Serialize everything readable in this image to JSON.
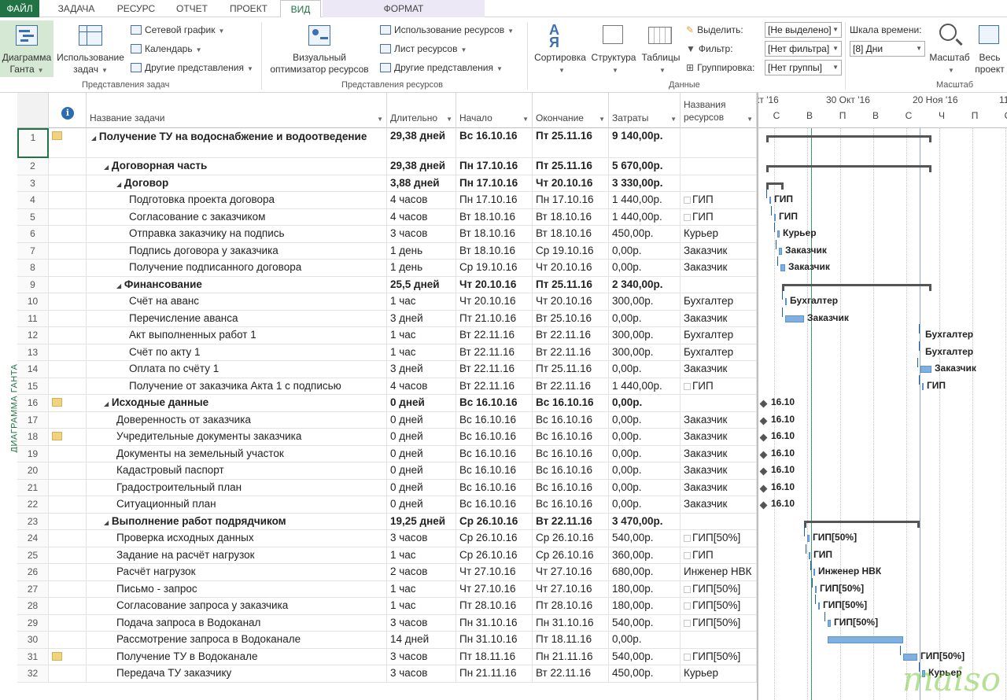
{
  "tabs": [
    {
      "label": "ФАЙЛ"
    },
    {
      "label": "ЗАДАЧА"
    },
    {
      "label": "РЕСУРС"
    },
    {
      "label": "ОТЧЕТ"
    },
    {
      "label": "ПРОЕКТ"
    },
    {
      "label": "ВИД"
    },
    {
      "label": "ФОРМАТ"
    }
  ],
  "ribbon": {
    "task_views": {
      "gantt_label1": "Диаграмма",
      "gantt_label2": "Ганта",
      "usage_label1": "Использование",
      "usage_label2": "задач",
      "network": "Сетевой график",
      "calendar": "Календарь",
      "other": "Другие представления",
      "group": "Представления задач"
    },
    "resource_views": {
      "visual1": "Визуальный",
      "visual2": "оптимизатор ресурсов",
      "usage": "Использование ресурсов",
      "sheet": "Лист ресурсов",
      "other": "Другие представления",
      "group": "Представления ресурсов"
    },
    "data": {
      "sort": "Сортировка",
      "outline": "Структура",
      "tables": "Таблицы",
      "highlight": "Выделить:",
      "filter": "Фильтр:",
      "group_by": "Группировка:",
      "highlight_val": "[Не выделено]",
      "filter_val": "[Нет фильтра]",
      "group_val": "[Нет группы]",
      "group": "Данные"
    },
    "zoom": {
      "timescale": "Шкала времени:",
      "timescale_val": "[8] Дни",
      "zoom": "Масштаб",
      "whole1": "Весь",
      "whole2": "проект",
      "group": "Масштаб"
    }
  },
  "side_label": "ДИАГРАММА ГАНТА",
  "columns": {
    "info": "i",
    "name": "Название задачи",
    "duration": "Длительно",
    "start": "Начало",
    "finish": "Окончание",
    "cost": "Затраты",
    "res1": "Названия",
    "res2": "ресурсов"
  },
  "rows": [
    {
      "id": "1",
      "note": true,
      "name": "Получение ТУ на водоснабжение и водоотведение",
      "dur": "29,38 дней",
      "start": "Вс 16.10.16",
      "finish": "Пт 25.11.16",
      "cost": "9 140,00р.",
      "res": "",
      "bold": true,
      "level": 0,
      "tall": true
    },
    {
      "id": "2",
      "name": "Договорная часть",
      "dur": "29,38 дней",
      "start": "Пн 17.10.16",
      "finish": "Пт 25.11.16",
      "cost": "5 670,00р.",
      "res": "",
      "bold": true,
      "level": 1
    },
    {
      "id": "3",
      "name": "Договор",
      "dur": "3,88 дней",
      "start": "Пн 17.10.16",
      "finish": "Чт 20.10.16",
      "cost": "3 330,00р.",
      "res": "",
      "bold": true,
      "level": 2
    },
    {
      "id": "4",
      "name": "Подготовка проекта договора",
      "dur": "4 часов",
      "start": "Пн 17.10.16",
      "finish": "Пн 17.10.16",
      "cost": "1 440,00р.",
      "res": "ГИП",
      "level": 3,
      "ric": true
    },
    {
      "id": "5",
      "name": "Согласование с заказчиком",
      "dur": "4 часов",
      "start": "Вт 18.10.16",
      "finish": "Вт 18.10.16",
      "cost": "1 440,00р.",
      "res": "ГИП",
      "level": 3,
      "ric": true
    },
    {
      "id": "6",
      "name": "Отправка заказчику на подпись",
      "dur": "3 часов",
      "start": "Вт 18.10.16",
      "finish": "Вт 18.10.16",
      "cost": "450,00р.",
      "res": "Курьер",
      "level": 3
    },
    {
      "id": "7",
      "name": "Подпись договора у заказчика",
      "dur": "1 день",
      "start": "Вт 18.10.16",
      "finish": "Ср 19.10.16",
      "cost": "0,00р.",
      "res": "Заказчик",
      "level": 3
    },
    {
      "id": "8",
      "name": "Получение подписанного договора",
      "dur": "1 день",
      "start": "Ср 19.10.16",
      "finish": "Чт 20.10.16",
      "cost": "0,00р.",
      "res": "Заказчик",
      "level": 3
    },
    {
      "id": "9",
      "name": "Финансование",
      "dur": "25,5 дней",
      "start": "Чт 20.10.16",
      "finish": "Пт 25.11.16",
      "cost": "2 340,00р.",
      "res": "",
      "bold": true,
      "level": 2
    },
    {
      "id": "10",
      "name": "Счёт на аванс",
      "dur": "1 час",
      "start": "Чт 20.10.16",
      "finish": "Чт 20.10.16",
      "cost": "300,00р.",
      "res": "Бухгалтер",
      "level": 3
    },
    {
      "id": "11",
      "name": "Перечисление аванса",
      "dur": "3 дней",
      "start": "Пт 21.10.16",
      "finish": "Вт 25.10.16",
      "cost": "0,00р.",
      "res": "Заказчик",
      "level": 3
    },
    {
      "id": "12",
      "name": "Акт выполненных работ 1",
      "dur": "1 час",
      "start": "Вт 22.11.16",
      "finish": "Вт 22.11.16",
      "cost": "300,00р.",
      "res": "Бухгалтер",
      "level": 3
    },
    {
      "id": "13",
      "name": "Счёт по акту 1",
      "dur": "1 час",
      "start": "Вт 22.11.16",
      "finish": "Вт 22.11.16",
      "cost": "300,00р.",
      "res": "Бухгалтер",
      "level": 3
    },
    {
      "id": "14",
      "name": "Оплата по счёту 1",
      "dur": "3 дней",
      "start": "Вт 22.11.16",
      "finish": "Пт 25.11.16",
      "cost": "0,00р.",
      "res": "Заказчик",
      "level": 3
    },
    {
      "id": "15",
      "name": "Получение от заказчика Акта 1 с подписью",
      "dur": "4 часов",
      "start": "Вт 22.11.16",
      "finish": "Вт 22.11.16",
      "cost": "1 440,00р.",
      "res": "ГИП",
      "level": 3,
      "ric": true
    },
    {
      "id": "16",
      "note": true,
      "name": "Исходные данные",
      "dur": "0 дней",
      "start": "Вс 16.10.16",
      "finish": "Вс 16.10.16",
      "cost": "0,00р.",
      "res": "",
      "bold": true,
      "level": 1
    },
    {
      "id": "17",
      "name": "Доверенность от заказчика",
      "dur": "0 дней",
      "start": "Вс 16.10.16",
      "finish": "Вс 16.10.16",
      "cost": "0,00р.",
      "res": "Заказчик",
      "level": 2
    },
    {
      "id": "18",
      "note": true,
      "name": "Учредительные документы заказчика",
      "dur": "0 дней",
      "start": "Вс 16.10.16",
      "finish": "Вс 16.10.16",
      "cost": "0,00р.",
      "res": "Заказчик",
      "level": 2
    },
    {
      "id": "19",
      "name": "Документы на земельный участок",
      "dur": "0 дней",
      "start": "Вс 16.10.16",
      "finish": "Вс 16.10.16",
      "cost": "0,00р.",
      "res": "Заказчик",
      "level": 2
    },
    {
      "id": "20",
      "name": "Кадастровый паспорт",
      "dur": "0 дней",
      "start": "Вс 16.10.16",
      "finish": "Вс 16.10.16",
      "cost": "0,00р.",
      "res": "Заказчик",
      "level": 2
    },
    {
      "id": "21",
      "name": "Градостроительный план",
      "dur": "0 дней",
      "start": "Вс 16.10.16",
      "finish": "Вс 16.10.16",
      "cost": "0,00р.",
      "res": "Заказчик",
      "level": 2
    },
    {
      "id": "22",
      "name": "Ситуационный план",
      "dur": "0 дней",
      "start": "Вс 16.10.16",
      "finish": "Вс 16.10.16",
      "cost": "0,00р.",
      "res": "Заказчик",
      "level": 2
    },
    {
      "id": "23",
      "name": "Выполнение работ подрядчиком",
      "dur": "19,25 дней",
      "start": "Ср 26.10.16",
      "finish": "Вт 22.11.16",
      "cost": "3 470,00р.",
      "res": "",
      "bold": true,
      "level": 1
    },
    {
      "id": "24",
      "name": "Проверка исходных данных",
      "dur": "3 часов",
      "start": "Ср 26.10.16",
      "finish": "Ср 26.10.16",
      "cost": "540,00р.",
      "res": "ГИП[50%]",
      "level": 2,
      "ric": true
    },
    {
      "id": "25",
      "name": "Задание на расчёт нагрузок",
      "dur": "1 час",
      "start": "Ср 26.10.16",
      "finish": "Ср 26.10.16",
      "cost": "360,00р.",
      "res": "ГИП",
      "level": 2,
      "ric": true
    },
    {
      "id": "26",
      "name": "Расчёт нагрузок",
      "dur": "2 часов",
      "start": "Чт 27.10.16",
      "finish": "Чт 27.10.16",
      "cost": "680,00р.",
      "res": "Инженер НВК",
      "level": 2
    },
    {
      "id": "27",
      "name": "Письмо - запрос",
      "dur": "1 час",
      "start": "Чт 27.10.16",
      "finish": "Чт 27.10.16",
      "cost": "180,00р.",
      "res": "ГИП[50%]",
      "level": 2,
      "ric": true
    },
    {
      "id": "28",
      "name": "Согласование запроса у заказчика",
      "dur": "1 час",
      "start": "Пт 28.10.16",
      "finish": "Пт 28.10.16",
      "cost": "180,00р.",
      "res": "ГИП[50%]",
      "level": 2,
      "ric": true
    },
    {
      "id": "29",
      "name": "Подача запроса в Водоканал",
      "dur": "3 часов",
      "start": "Пн 31.10.16",
      "finish": "Пн 31.10.16",
      "cost": "540,00р.",
      "res": "ГИП[50%]",
      "level": 2,
      "ric": true
    },
    {
      "id": "30",
      "name": "Рассмотрение запроса в Водоканале",
      "dur": "14 дней",
      "start": "Пн 31.10.16",
      "finish": "Пт 18.11.16",
      "cost": "0,00р.",
      "res": "",
      "level": 2
    },
    {
      "id": "31",
      "note": true,
      "name": "Получение ТУ  в Водоканале",
      "dur": "3 часов",
      "start": "Пт 18.11.16",
      "finish": "Пн 21.11.16",
      "cost": "540,00р.",
      "res": "ГИП[50%]",
      "level": 2,
      "ric": true
    },
    {
      "id": "32",
      "name": "Передача ТУ заказчику",
      "dur": "3 часов",
      "start": "Пн 21.11.16",
      "finish": "Вт 22.11.16",
      "cost": "450,00р.",
      "res": "Курьер",
      "level": 2
    }
  ],
  "timescale": {
    "major": [
      "кт '16",
      "30 Окт '16",
      "20 Ноя '16",
      "11"
    ],
    "minor": [
      "С",
      "В",
      "П",
      "В",
      "С",
      "Ч",
      "П",
      "С"
    ]
  },
  "gantt_labels": {
    "r4": "ГИП",
    "r5": "ГИП",
    "r6": "Курьер",
    "r7": "Заказчик",
    "r8": "Заказчик",
    "r10": "Бухгалтер",
    "r11": "Заказчик",
    "r12": "Бухгалтер",
    "r13": "Бухгалтер",
    "r14": "Заказчик",
    "r15": "ГИП",
    "r16": "16.10",
    "r17": "16.10",
    "r18": "16.10",
    "r19": "16.10",
    "r20": "16.10",
    "r21": "16.10",
    "r22": "16.10",
    "r24": "ГИП[50%]",
    "r25": "ГИП",
    "r26": "Инженер НВК",
    "r27": "ГИП[50%]",
    "r28": "ГИП[50%]",
    "r29": "ГИП[50%]",
    "r31": "ГИП[50%]",
    "r32": "Курьер"
  },
  "watermark": "maiso"
}
